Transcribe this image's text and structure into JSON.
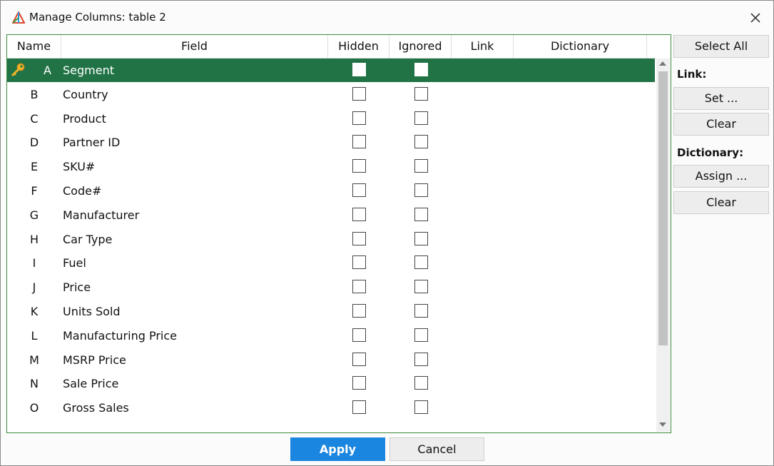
{
  "window": {
    "title": "Manage Columns: table 2"
  },
  "columns": {
    "name": "Name",
    "field": "Field",
    "hidden": "Hidden",
    "ignored": "Ignored",
    "link": "Link",
    "dictionary": "Dictionary"
  },
  "rows": [
    {
      "name": "A",
      "field": "Segment",
      "key": true,
      "selected": true
    },
    {
      "name": "B",
      "field": "Country"
    },
    {
      "name": "C",
      "field": "Product"
    },
    {
      "name": "D",
      "field": "Partner ID"
    },
    {
      "name": "E",
      "field": "SKU#"
    },
    {
      "name": "F",
      "field": "Code#"
    },
    {
      "name": "G",
      "field": "Manufacturer"
    },
    {
      "name": "H",
      "field": "Car Type"
    },
    {
      "name": "I",
      "field": "Fuel"
    },
    {
      "name": "J",
      "field": "Price"
    },
    {
      "name": "K",
      "field": "Units Sold"
    },
    {
      "name": "L",
      "field": "Manufacturing Price"
    },
    {
      "name": "M",
      "field": "MSRP Price"
    },
    {
      "name": "N",
      "field": "Sale Price"
    },
    {
      "name": "O",
      "field": "Gross Sales"
    }
  ],
  "side": {
    "select_all": "Select All",
    "link_label": "Link:",
    "link_set": "Set ...",
    "link_clear": "Clear",
    "dictionary_label": "Dictionary:",
    "dictionary_assign": "Assign ...",
    "dictionary_clear": "Clear"
  },
  "footer": {
    "apply": "Apply",
    "cancel": "Cancel"
  },
  "colors": {
    "selected_row": "#217346",
    "apply_button": "#1a86e0",
    "grid_border": "#3d8a3d"
  },
  "icons": {
    "app": "app-logo-icon",
    "close": "close-icon",
    "key": "key-icon"
  }
}
